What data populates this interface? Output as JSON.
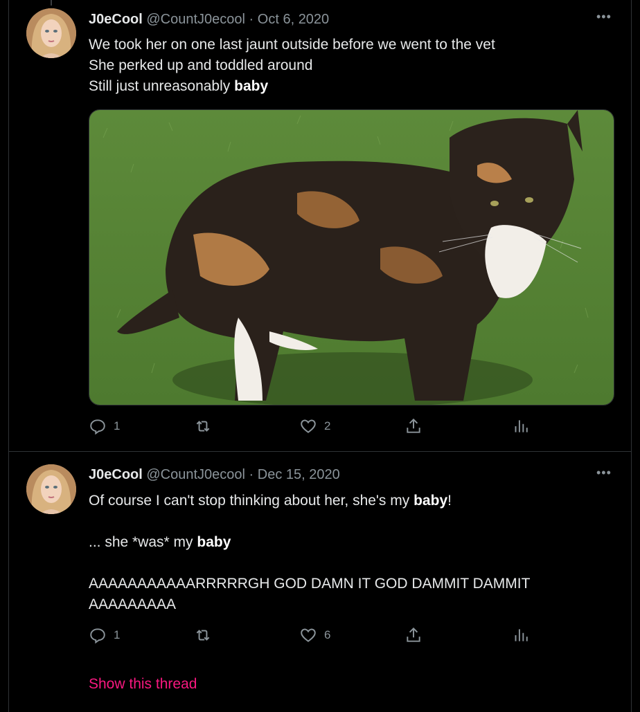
{
  "tweets": [
    {
      "name": "J0eCool",
      "handle": "@CountJ0ecool",
      "separator": "·",
      "date": "Oct 6, 2020",
      "more": "•••",
      "lines": [
        [
          {
            "t": "We took her on one last jaunt outside before we went to the vet"
          }
        ],
        [
          {
            "t": "She perked up and toddled around"
          }
        ],
        [
          {
            "t": "Still just unreasonably "
          },
          {
            "t": "baby",
            "b": true
          }
        ]
      ],
      "replies": "1",
      "retweets": "",
      "likes": "2"
    },
    {
      "name": "J0eCool",
      "handle": "@CountJ0ecool",
      "separator": "·",
      "date": "Dec 15, 2020",
      "more": "•••",
      "lines": [
        [
          {
            "t": "Of course I can't stop thinking about her, she's my "
          },
          {
            "t": "baby",
            "b": true
          },
          {
            "t": "!"
          }
        ],
        [
          {
            "t": ""
          }
        ],
        [
          {
            "t": "... she *was* my "
          },
          {
            "t": "baby",
            "b": true
          }
        ],
        [
          {
            "t": ""
          }
        ],
        [
          {
            "t": "AAAAAAAAAAARRRRRGH GOD DAMN IT GOD DAMMIT DAMMIT"
          }
        ],
        [
          {
            "t": "AAAAAAAAA"
          }
        ]
      ],
      "replies": "1",
      "retweets": "",
      "likes": "6"
    }
  ],
  "show_thread": "Show this thread",
  "colors": {
    "background": "#000000",
    "accent": "#f91880",
    "muted": "#8b949a"
  },
  "icons": [
    "reply-icon",
    "retweet-icon",
    "like-icon",
    "share-icon",
    "analytics-icon",
    "more-icon"
  ]
}
